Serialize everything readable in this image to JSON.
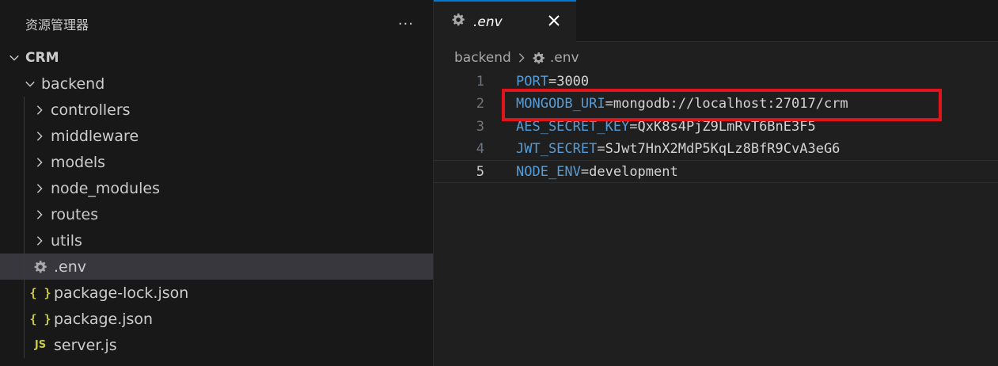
{
  "explorer": {
    "title": "资源管理器",
    "more_label": "···",
    "tree": [
      {
        "label": "CRM",
        "type": "folder-open",
        "depth": 0
      },
      {
        "label": "backend",
        "type": "folder-open",
        "depth": 1
      },
      {
        "label": "controllers",
        "type": "folder-closed",
        "depth": 2
      },
      {
        "label": "middleware",
        "type": "folder-closed",
        "depth": 2
      },
      {
        "label": "models",
        "type": "folder-closed",
        "depth": 2
      },
      {
        "label": "node_modules",
        "type": "folder-closed",
        "depth": 2
      },
      {
        "label": "routes",
        "type": "folder-closed",
        "depth": 2
      },
      {
        "label": "utils",
        "type": "folder-closed",
        "depth": 2
      },
      {
        "label": ".env",
        "type": "gear-file",
        "depth": 2,
        "selected": true
      },
      {
        "label": "package-lock.json",
        "type": "json-file",
        "depth": 2
      },
      {
        "label": "package.json",
        "type": "json-file",
        "depth": 2
      },
      {
        "label": "server.js",
        "type": "js-file",
        "depth": 2
      }
    ],
    "json_icon": "{ }",
    "js_icon": "JS"
  },
  "editor": {
    "tab": {
      "label": ".env",
      "icon": "gear-icon"
    },
    "breadcrumb": {
      "folder": "backend",
      "file": ".env"
    },
    "lines": [
      {
        "num": "1",
        "key": "PORT",
        "eq": "=",
        "value": "3000"
      },
      {
        "num": "2",
        "key": "MONGODB_URI",
        "eq": "=",
        "value": "mongodb://localhost:27017/crm"
      },
      {
        "num": "3",
        "key": "AES_SECRET_KEY",
        "eq": "=",
        "value": "QxK8s4PjZ9LmRvT6BnE3F5"
      },
      {
        "num": "4",
        "key": "JWT_SECRET",
        "eq": "=",
        "value": "SJwt7HnX2MdP5KqLz8BfR9CvA3eG6"
      },
      {
        "num": "5",
        "key": "NODE_ENV",
        "eq": "=",
        "value": "development"
      }
    ],
    "active_line": 5,
    "highlighted_line": 2
  },
  "colors": {
    "key": "#569cd6",
    "value": "#d4d4d4",
    "highlight": "#e0151b",
    "tab_accent": "#0078d4",
    "file_icon_yellow": "#cbcb41"
  }
}
